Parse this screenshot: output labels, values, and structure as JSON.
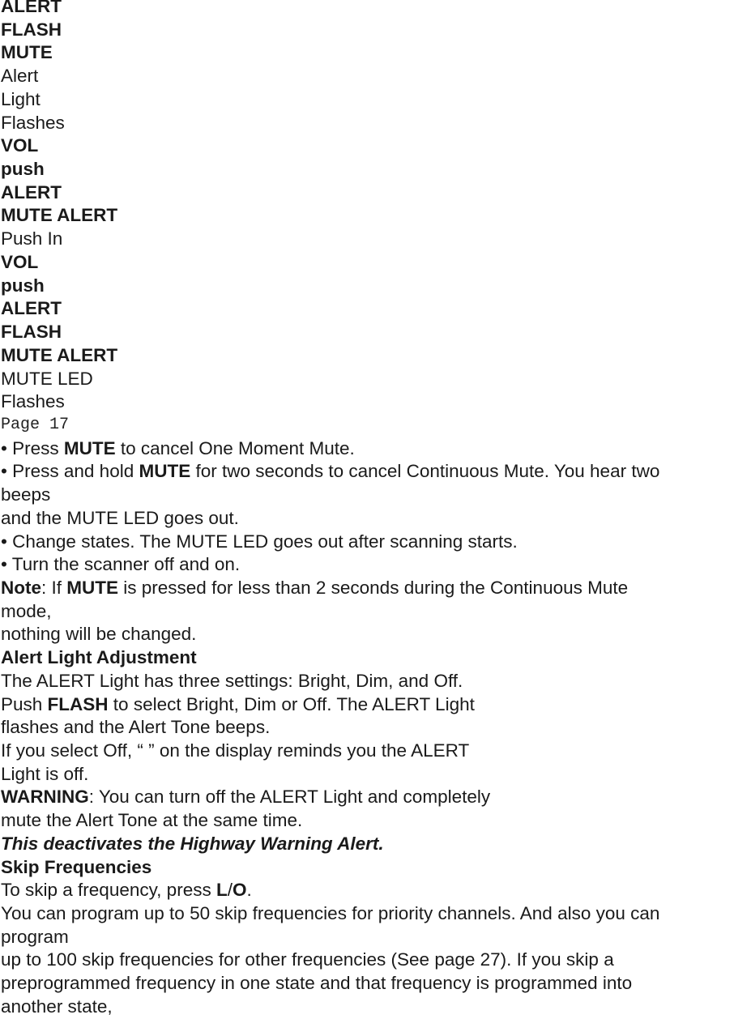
{
  "labels": [
    {
      "text": "ALERT",
      "bold": true
    },
    {
      "text": "FLASH",
      "bold": true
    },
    {
      "text": "MUTE",
      "bold": true
    },
    {
      "text": "Alert",
      "bold": false
    },
    {
      "text": "Light",
      "bold": false
    },
    {
      "text": "Flashes",
      "bold": false
    },
    {
      "text": "VOL",
      "bold": true
    },
    {
      "text": "push",
      "bold": true
    },
    {
      "text": "ALERT",
      "bold": true
    },
    {
      "text": "MUTE ALERT",
      "bold": true
    },
    {
      "text": "Push In",
      "bold": false
    },
    {
      "text": "VOL",
      "bold": true
    },
    {
      "text": "push",
      "bold": true
    },
    {
      "text": "ALERT",
      "bold": true
    },
    {
      "text": "FLASH",
      "bold": true
    },
    {
      "text": "MUTE ALERT",
      "bold": true
    },
    {
      "text": "MUTE LED",
      "bold": false
    },
    {
      "text": "Flashes",
      "bold": false
    }
  ],
  "page_number": "Page 17",
  "bullets": {
    "b1": {
      "pre": "• Press ",
      "bold": "MUTE",
      "post": " to cancel One Moment Mute."
    },
    "b2": {
      "pre": "• Press and hold ",
      "bold": "MUTE",
      "post": " for two seconds to cancel Continuous Mute. You hear two"
    },
    "b2_cont1": "beeps",
    "b2_cont2": "and the MUTE LED goes out.",
    "b3": "• Change states. The MUTE LED goes out after scanning starts.",
    "b4": "• Turn the scanner off and on."
  },
  "note": {
    "label": "Note",
    "pre": ": If ",
    "bold": "MUTE",
    "post": " is pressed for less than 2 seconds during the Continuous Mute",
    "cont1": "mode,",
    "cont2": "nothing will be changed."
  },
  "alert_light": {
    "heading": "Alert Light Adjustment",
    "line1": "The ALERT Light has three settings: Bright, Dim, and Off.",
    "line2_pre": "Push ",
    "line2_bold": "FLASH",
    "line2_post": " to select Bright, Dim or Off. The ALERT Light",
    "line3": "flashes and the Alert Tone beeps.",
    "line4": "If you select Off, “ ” on the display reminds you the ALERT",
    "line5": "Light is off.",
    "warning_label": "WARNING",
    "warning_text": ": You can turn off the ALERT Light and completely",
    "warning_cont": "mute the Alert Tone at the same time.",
    "emphasis": "This deactivates the Highway Warning Alert."
  },
  "skip": {
    "heading": "Skip Frequencies",
    "line1_pre": "To skip a frequency, press ",
    "line1_bold1": "L",
    "line1_slash": "/",
    "line1_bold2": "O",
    "line1_post": ".",
    "line2": "You can program up to 50 skip frequencies for priority channels. And also you can",
    "line3": "program",
    "line4": "up to 100 skip frequencies for other frequencies (See page 27). If you skip a",
    "line5": "preprogrammed frequency in one state and that frequency is programmed into",
    "line6": "another state,"
  }
}
